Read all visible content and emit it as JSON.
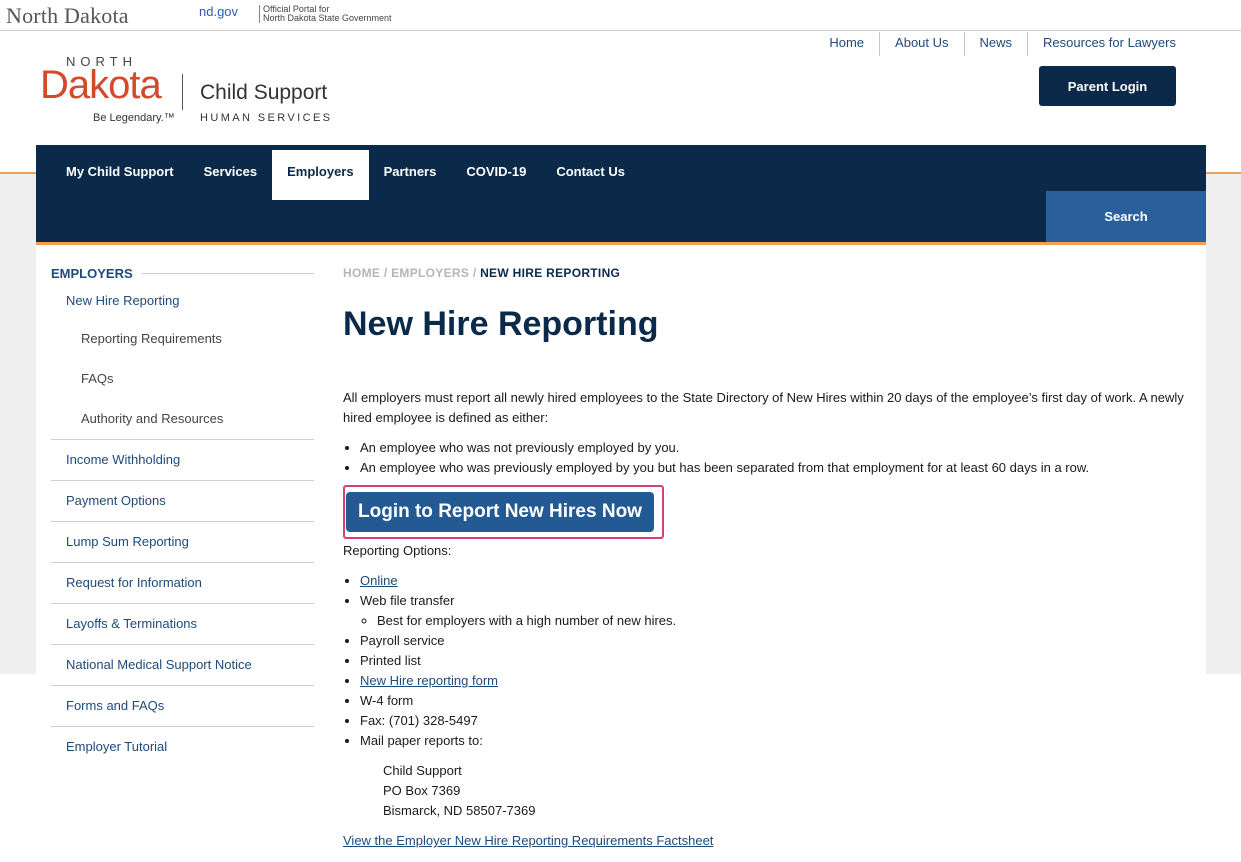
{
  "statebar": {
    "state_name": "North Dakota",
    "portal_domain": "nd.gov",
    "portal_line1": "Official Portal for",
    "portal_line2": "North Dakota State Government"
  },
  "logo": {
    "north": "NORTH",
    "dakota": "Dakota",
    "tagline": "Be Legendary.™",
    "program": "Child Support",
    "department": "HUMAN SERVICES"
  },
  "utility_nav": [
    "Home",
    "About Us",
    "News",
    "Resources for Lawyers"
  ],
  "parent_login": "Parent Login",
  "main_nav": {
    "tabs": [
      {
        "label": "My Child Support",
        "active": false
      },
      {
        "label": "Services",
        "active": false
      },
      {
        "label": "Employers",
        "active": true
      },
      {
        "label": "Partners",
        "active": false
      },
      {
        "label": "COVID-19",
        "active": false
      },
      {
        "label": "Contact Us",
        "active": false
      }
    ],
    "search_label": "Search"
  },
  "sidebar": {
    "heading": "EMPLOYERS",
    "current": "New Hire Reporting",
    "subitems": [
      "Reporting Requirements",
      "FAQs",
      "Authority and Resources"
    ],
    "items": [
      "Income Withholding",
      "Payment Options",
      "Lump Sum Reporting",
      "Request for Information",
      "Layoffs & Terminations",
      "National Medical Support Notice",
      "Forms and FAQs",
      "Employer Tutorial"
    ]
  },
  "breadcrumb": {
    "home": "HOME",
    "sep": "/",
    "section": "EMPLOYERS",
    "current": "NEW HIRE REPORTING"
  },
  "page": {
    "title": "New Hire Reporting",
    "intro": "All employers must report all newly hired employees to the State Directory of New Hires within 20 days of the employee’s first day of work. A newly hired employee is defined as either:",
    "definitions": [
      "An employee who was not previously employed by you.",
      "An employee who was previously employed by you but has been separated from that employment for at least 60 days in a row."
    ],
    "cta_label": "Login to Report New Hires Now",
    "options_label": "Reporting Options:",
    "options": {
      "online": "Online",
      "web_transfer": "Web file transfer",
      "web_transfer_note": "Best for employers with a high number of new hires.",
      "payroll": "Payroll service",
      "printed": "Printed list",
      "form_link": "New Hire reporting form",
      "w4": "W-4 form",
      "fax": "Fax: (701) 328-5497",
      "mail": "Mail paper reports to:"
    },
    "address": [
      "Child Support",
      "PO Box 7369",
      "Bismarck, ND 58507-7369"
    ],
    "factsheet_link": "View the Employer New Hire Reporting Requirements Factsheet"
  },
  "colors": {
    "navy": "#0b2a4a",
    "link_blue": "#1e4a7a",
    "cta_blue": "#245a94",
    "search_blue": "#2a5f9a",
    "orange_accent": "#f0a050",
    "dakota_red": "#d24a2a",
    "highlight_pink": "#d8407a"
  }
}
